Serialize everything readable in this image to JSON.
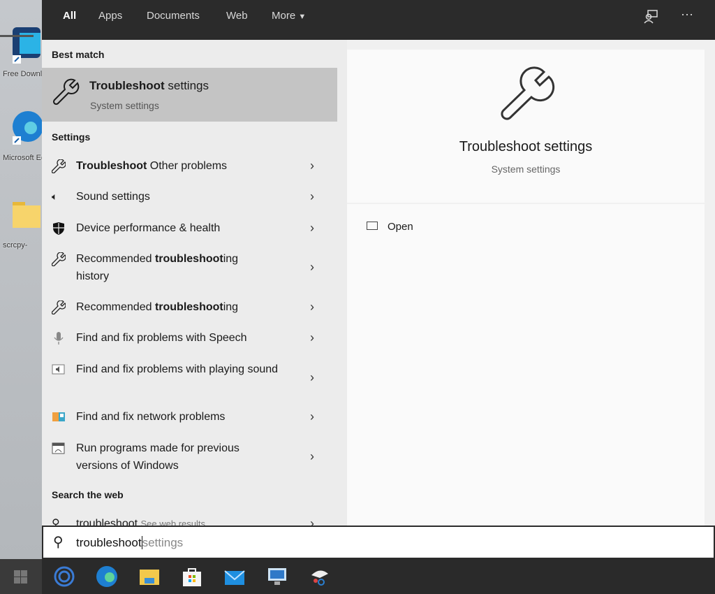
{
  "desktop": {
    "icons": [
      {
        "label": "Free Download"
      },
      {
        "label": "Microsoft Edge"
      },
      {
        "label": "scrcpy-"
      }
    ]
  },
  "tabs": [
    {
      "label": "All"
    },
    {
      "label": "Apps"
    },
    {
      "label": "Documents"
    },
    {
      "label": "Web"
    },
    {
      "label": "More"
    }
  ],
  "topbar_icons": [
    "feedback-icon",
    "more-options-icon"
  ],
  "best_match": {
    "heading": "Best match",
    "title_bold": "Troubleshoot",
    "title_rest": " settings",
    "subtitle": "System settings"
  },
  "settings": {
    "heading": "Settings",
    "items": [
      {
        "icon": "wrench-icon",
        "pre": "",
        "bold": "Troubleshoot",
        "post": " Other problems"
      },
      {
        "icon": "speaker-icon",
        "pre": "Sound settings",
        "bold": "",
        "post": ""
      },
      {
        "icon": "shield-icon",
        "pre": "Device performance & health",
        "bold": "",
        "post": ""
      },
      {
        "icon": "wrench-icon",
        "pre": "Recommended ",
        "bold": "troubleshoot",
        "post": "ing history"
      },
      {
        "icon": "wrench-icon",
        "pre": "Recommended ",
        "bold": "troubleshoot",
        "post": "ing"
      },
      {
        "icon": "microphone-icon",
        "pre": "Find and fix problems with Speech",
        "bold": "",
        "post": ""
      },
      {
        "icon": "audio-troubleshooter-icon",
        "pre": "Find and fix problems with playing sound",
        "bold": "",
        "post": ""
      },
      {
        "icon": "network-troubleshooter-icon",
        "pre": "Find and fix network problems",
        "bold": "",
        "post": ""
      },
      {
        "icon": "compatibility-icon",
        "pre": "Run programs made for previous versions of Windows",
        "bold": "",
        "post": ""
      }
    ]
  },
  "web": {
    "heading": "Search the web",
    "query": "troubleshoot",
    "hint": "See web results"
  },
  "preview": {
    "title": "Troubleshoot settings",
    "subtitle": "System settings",
    "open_label": "Open"
  },
  "search": {
    "typed": "troubleshoot",
    "suggestion": "settings"
  },
  "taskbar": [
    "start-icon",
    "cortana-icon",
    "edge-icon",
    "file-explorer-icon",
    "store-icon",
    "mail-icon",
    "remote-desktop-icon",
    "snipping-tool-icon"
  ],
  "colors": {
    "topbar": "#2b2b2b",
    "selected": "#c4c4c4",
    "taskbar": "#2a2a2a"
  }
}
